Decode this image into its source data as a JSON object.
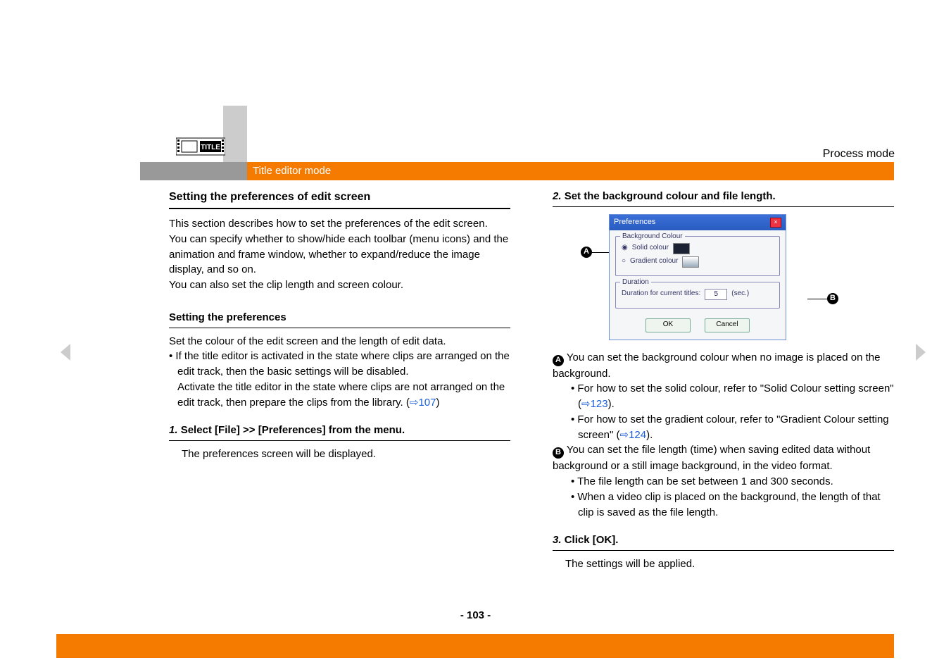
{
  "header": {
    "mode_label": "Process mode",
    "bar_label": "Title editor mode",
    "icon_text": "TITLE"
  },
  "left": {
    "h1": "Setting the preferences of edit screen",
    "p1": "This section describes how to set the preferences of the edit screen.",
    "p2": "You can specify whether to show/hide each toolbar (menu icons) and the animation and frame window, whether to expand/reduce the image display, and so on.",
    "p3": "You can also set the clip length and screen colour.",
    "h2": "Setting the preferences",
    "p4": "Set the colour of the edit screen and the length of edit data.",
    "bullet1a": "• If the title editor is activated in the state where clips are arranged on the edit track, then the basic settings will be disabled.",
    "bullet1b": "Activate the title editor in the state where clips are not arranged on the edit track, then prepare the clips from the library. (",
    "bullet1_link": "⇨107",
    "bullet1c": ")",
    "step1_num": "1.",
    "step1_label": "Select [File] >> [Preferences] from the menu.",
    "step1_body": "The preferences screen will be displayed."
  },
  "right": {
    "step2_num": "2.",
    "step2_label": "Set the background colour and file length.",
    "dialog": {
      "title": "Preferences",
      "group_bg": "Background Colour",
      "radio_solid": "Solid colour",
      "radio_grad": "Gradient colour",
      "group_dur": "Duration",
      "dur_label": "Duration for current titles:",
      "dur_value": "5",
      "dur_unit": "(sec.)",
      "ok": "OK",
      "cancel": "Cancel"
    },
    "a_line1": "You can set the background colour when no image is placed on the background.",
    "a_sub1a": "• For how to set the solid colour, refer to \"Solid Colour setting screen\" (",
    "a_sub1_link": "⇨123",
    "a_sub1b": ").",
    "a_sub2a": "• For how to set the gradient colour, refer to \"Gradient Colour setting screen\" (",
    "a_sub2_link": "⇨124",
    "a_sub2b": ").",
    "b_line1": "You can set the file length (time) when saving edited data without background or a still image background, in the video format.",
    "b_sub1": "• The file length can be set between 1 and 300 seconds.",
    "b_sub2": "• When a video clip is placed on the background, the length of that clip is saved as the file length.",
    "step3_num": "3.",
    "step3_label": "Click [OK].",
    "step3_body": "The settings will be applied."
  },
  "footer": {
    "page": "- 103 -"
  }
}
